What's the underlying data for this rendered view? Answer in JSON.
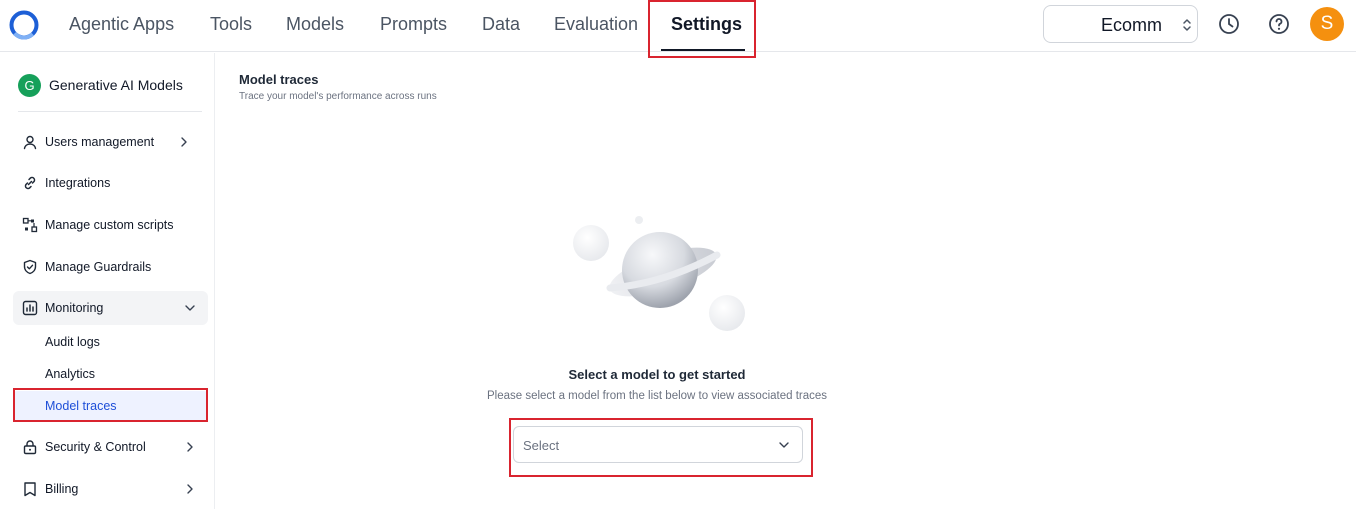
{
  "header": {
    "nav_tabs": [
      {
        "label": "Agentic Apps"
      },
      {
        "label": "Tools"
      },
      {
        "label": "Models"
      },
      {
        "label": "Prompts"
      },
      {
        "label": "Data"
      },
      {
        "label": "Evaluation"
      },
      {
        "label": "Settings",
        "active": true
      }
    ],
    "workspace": "Ecomm",
    "avatar_initial": "S",
    "icons": [
      "history-clock-icon",
      "help-question-icon"
    ]
  },
  "sidebar": {
    "org": {
      "initial": "G",
      "name": "Generative AI Models"
    },
    "items": [
      {
        "label": "Users management",
        "icon": "user-icon",
        "chevron": "right"
      },
      {
        "label": "Integrations",
        "icon": "link-icon"
      },
      {
        "label": "Manage custom scripts",
        "icon": "scripts-icon"
      },
      {
        "label": "Manage Guardrails",
        "icon": "shield-icon"
      },
      {
        "label": "Monitoring",
        "icon": "bar-chart-icon",
        "chevron": "down",
        "expanded": true,
        "children": [
          {
            "label": "Audit logs"
          },
          {
            "label": "Analytics"
          },
          {
            "label": "Model traces",
            "active": true
          }
        ]
      },
      {
        "label": "Security & Control",
        "icon": "lock-icon",
        "chevron": "right"
      },
      {
        "label": "Billing",
        "icon": "book-icon",
        "chevron": "right"
      }
    ]
  },
  "main": {
    "title": "Model traces",
    "subtitle": "Trace your model's performance across runs",
    "empty_state": {
      "title": "Select a model to get started",
      "description": "Please select a model from the list below to view associated traces",
      "illustration": "planet-illustration"
    },
    "model_select": {
      "placeholder": "Select"
    }
  },
  "colors": {
    "highlight_box": "#d9242f",
    "active_link": "#1e4fd8",
    "avatar": "#f5900f",
    "org_badge": "#16a05a"
  }
}
